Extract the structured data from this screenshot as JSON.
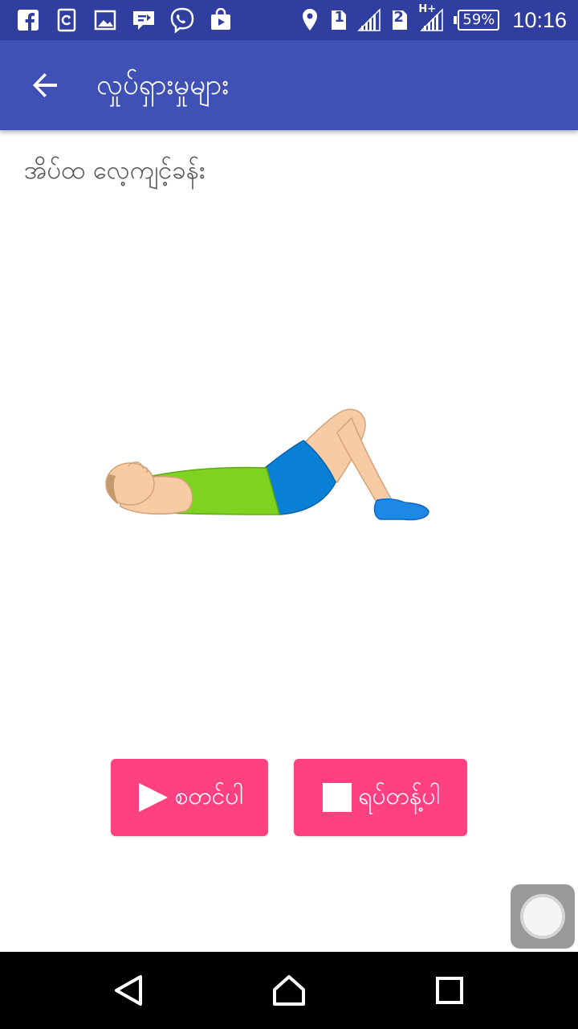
{
  "status_bar": {
    "sim1": "1",
    "sim2": "2",
    "network_type": "H+",
    "battery": "59%",
    "time": "10:16",
    "left_icons": [
      "facebook-icon",
      "refresh-icon",
      "gallery-icon",
      "message-icon",
      "viber-icon",
      "store-icon"
    ],
    "right_icons": [
      "location-icon",
      "sim1-icon",
      "signal-icon",
      "sim2-icon",
      "signal-icon",
      "battery-icon"
    ]
  },
  "app_bar": {
    "title": "လှုပ်ရှားမှုများ",
    "back_icon": "arrow-left-icon"
  },
  "exercise": {
    "title": "အိပ်ထ လေ့ကျင့်ခန်း",
    "illustration": "sit-up-person"
  },
  "buttons": {
    "start_label": "စတင်ပါ",
    "stop_label": "ရပ်တန့်ပါ",
    "start_icon": "play-icon",
    "stop_icon": "stop-icon"
  },
  "colors": {
    "status_bar": "#303f9f",
    "app_bar": "#3f51b5",
    "accent": "#ff4081",
    "nav_bar": "#000000"
  },
  "nav_bar": {
    "icons": [
      "back-triangle-icon",
      "home-icon",
      "recents-icon"
    ]
  }
}
